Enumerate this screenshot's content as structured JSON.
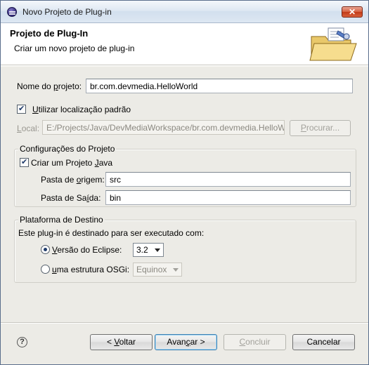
{
  "window": {
    "title": "Novo Projeto de Plug-in"
  },
  "banner": {
    "title": "Projeto de Plug-In",
    "description": "Criar um novo projeto de plug-in"
  },
  "project": {
    "name_label_pre": "Nome do ",
    "name_label_key": "p",
    "name_label_post": "rojeto:",
    "name_value": "br.com.devmedia.HelloWorld",
    "use_default_key": "U",
    "use_default_rest": "tilizar localização padrão",
    "location_label_key": "L",
    "location_label_rest": "ocal:",
    "location_value": "E:/Projects/Java/DevMediaWorkspace/br.com.devmedia.HelloW",
    "browse_key": "P",
    "browse_rest": "rocurar..."
  },
  "config_group": {
    "title": "Configurações do Projeto",
    "java_pre": "Criar um Projeto ",
    "java_key": "J",
    "java_post": "ava",
    "source_pre": "Pasta de ",
    "source_key": "o",
    "source_post": "rigem:",
    "source_value": "src",
    "output_pre": "Pasta de Sa",
    "output_key": "í",
    "output_post": "da:",
    "output_value": "bin"
  },
  "platform_group": {
    "title": "Plataforma de Destino",
    "intro": "Este plug-in é destinado para ser executado com:",
    "eclipse_key": "V",
    "eclipse_rest": "ersão do Eclipse:",
    "eclipse_version": "3.2",
    "osgi_key": "u",
    "osgi_rest": "ma estrutura OSGi:",
    "osgi_framework": "Equinox"
  },
  "footer": {
    "help_glyph": "?",
    "back_pre": "< ",
    "back_key": "V",
    "back_post": "oltar",
    "next_pre": "Avan",
    "next_key": "ç",
    "next_post": "ar >",
    "finish_key": "C",
    "finish_rest": "oncluir",
    "cancel": "Cancelar"
  },
  "icons": {
    "app": "eclipse-icon",
    "banner": "plugin-folder-icon",
    "help": "help-icon"
  },
  "colors": {
    "default_button_border": "#3c7fb1",
    "title_close": "#c13a18"
  }
}
